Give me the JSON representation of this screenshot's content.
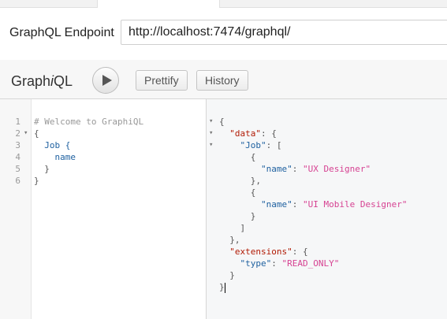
{
  "endpoint": {
    "label": "GraphQL Endpoint",
    "value": "http://localhost:7474/graphql/"
  },
  "toolbar": {
    "logo_prefix": "Graph",
    "logo_italic": "i",
    "logo_suffix": "QL",
    "prettify_label": "Prettify",
    "history_label": "History"
  },
  "query": {
    "line_numbers": [
      "1",
      "2",
      "3",
      "4",
      "5",
      "6"
    ],
    "lines": [
      "# Welcome to GraphiQL",
      "{",
      "  Job {",
      "    name",
      "  }",
      "}"
    ]
  },
  "result": {
    "open_brace": "{",
    "data_key": "\"data\"",
    "job_key": "\"Job\"",
    "name_key": "\"name\"",
    "name_1": "\"UX Designer\"",
    "name_2": "\"UI Mobile Designer\"",
    "extensions_key": "\"extensions\"",
    "type_key": "\"type\"",
    "type_value": "\"READ_ONLY\""
  }
}
